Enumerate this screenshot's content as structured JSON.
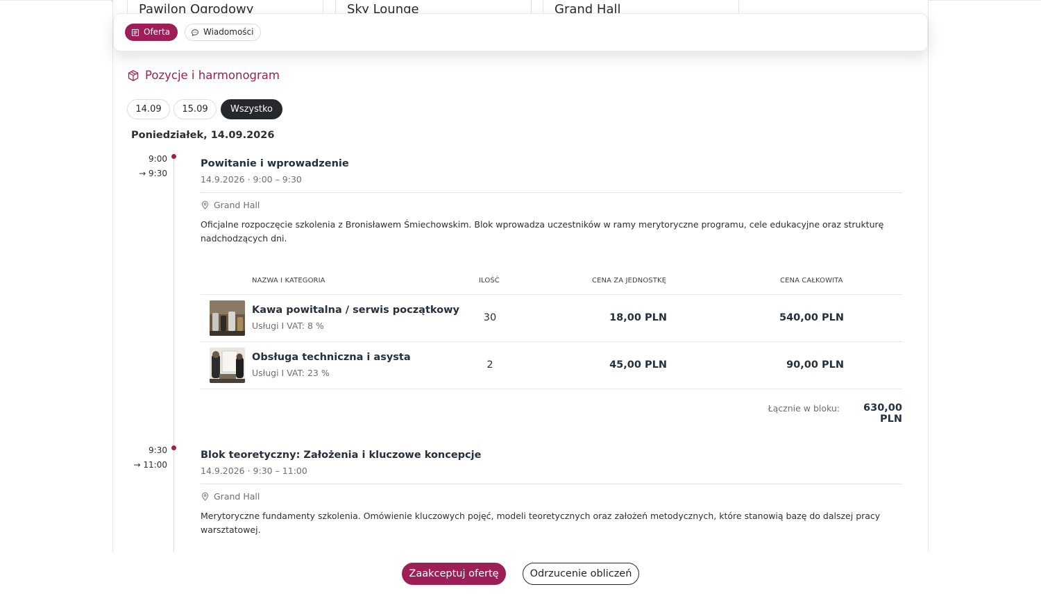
{
  "venues": [
    "Pawilon Ogrodowy",
    "Sky Lounge",
    "Grand Hall"
  ],
  "tabs": [
    {
      "label": "Oferta",
      "icon": "document-icon",
      "active": true
    },
    {
      "label": "Wiadomości",
      "icon": "chat-bubble-icon",
      "active": false
    }
  ],
  "section": {
    "title": "Pozycje i harmonogram",
    "icon": "box-icon"
  },
  "date_filters": [
    "14.09",
    "15.09",
    "Wszystko"
  ],
  "date_filter_selected": "Wszystko",
  "day_heading": "Poniedziałek, 14.09.2026",
  "blocks": [
    {
      "start": "9:00",
      "end": "→ 9:30",
      "title": "Powitanie i wprowadzenie",
      "subtitle": "14.9.2026 · 9:00 – 9:30",
      "location": "Grand Hall",
      "description": "Oficjalne rozpoczęcie szkolenia z Bronisławem Śmiechowskim. Blok wprowadza uczestników w ramy merytoryczne programu, cele edukacyjne oraz strukturę nadchodzących dni.",
      "table": {
        "headers": [
          "NAZWA I KATEGORIA",
          "ILOŚĆ",
          "CENA ZA JEDNOSTKĘ",
          "CENA CAŁKOWITA"
        ],
        "rows": [
          {
            "name": "Kawa powitalna / serwis początkowy",
            "meta": "Usługi I  VAT: 8 %",
            "qty": "30",
            "unit_price": "18,00 PLN",
            "total": "540,00 PLN"
          },
          {
            "name": "Obsługa techniczna i asysta",
            "meta": "Usługi I  VAT: 23 %",
            "qty": "2",
            "unit_price": "45,00 PLN",
            "total": "90,00 PLN"
          }
        ]
      },
      "block_total_label": "Łącznie w bloku:",
      "block_total_value": "630,00 PLN"
    },
    {
      "start": "9:30",
      "end": "→ 11:00",
      "title": "Blok teoretyczny: Założenia i kluczowe koncepcje",
      "subtitle": "14.9.2026 · 9:30 – 11:00",
      "location": "Grand Hall",
      "description": "Merytoryczne fundamenty szkolenia. Omówienie kluczowych pojęć, modeli teoretycznych oraz założeń metodycznych, które stanowią bazę do dalszej pracy warsztatowej."
    }
  ],
  "actions": {
    "accept": "Zaakceptuj ofertę",
    "reject": "Odrzucenie obliczeń"
  },
  "colors": {
    "accent": "#9e1e56",
    "dark": "#25282c"
  }
}
